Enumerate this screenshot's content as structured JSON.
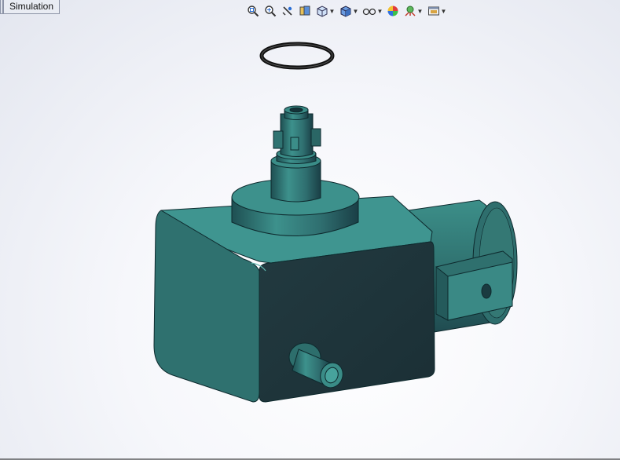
{
  "tabs": [
    {
      "label": ""
    },
    {
      "label": "Simulation"
    }
  ],
  "heads_up_toolbar": [
    {
      "icon": "zoom-to-fit-icon"
    },
    {
      "icon": "zoom-to-area-icon"
    },
    {
      "icon": "previous-view-icon"
    },
    {
      "icon": "section-view-icon"
    },
    {
      "icon": "view-orientation-icon",
      "dropdown": true
    },
    {
      "icon": "display-style-icon",
      "dropdown": true
    },
    {
      "icon": "hide-show-items-icon",
      "dropdown": true
    },
    {
      "icon": "edit-appearance-icon"
    },
    {
      "icon": "apply-scene-icon",
      "dropdown": true
    },
    {
      "icon": "view-settings-icon",
      "dropdown": true
    }
  ],
  "model": {
    "body_color": "#3a8a86",
    "dark_face_color": "#1f3a3c",
    "oring_color": "#1a1a1a"
  }
}
